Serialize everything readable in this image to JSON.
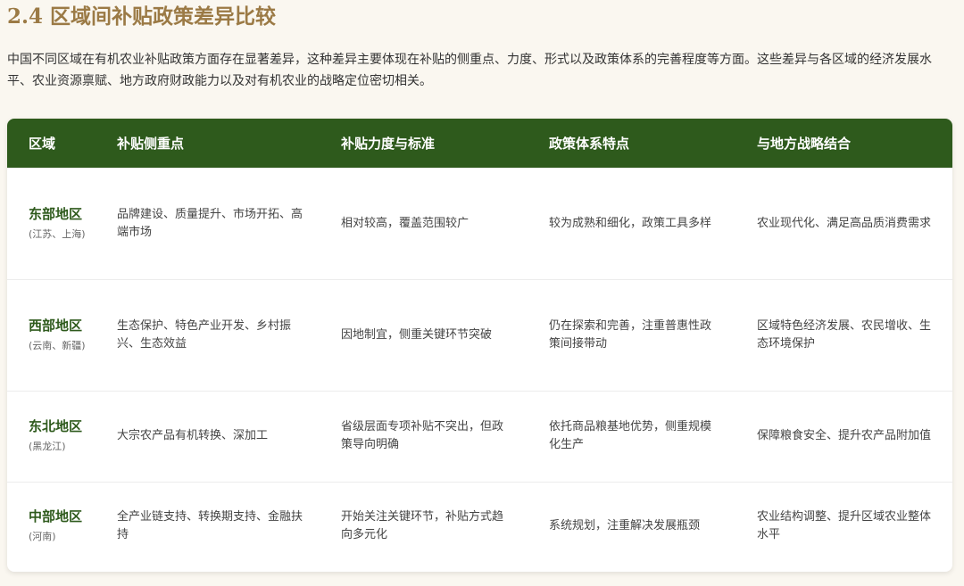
{
  "heading": "2.4 区域间补贴政策差异比较",
  "intro": "中国不同区域在有机农业补贴政策方面存在显著差异，这种差异主要体现在补贴的侧重点、力度、形式以及政策体系的完善程度等方面。这些差异与各区域的经济发展水平、农业资源禀赋、地方政府财政能力以及对有机农业的战略定位密切相关。",
  "colors": {
    "heading": "#9b7a45",
    "header_bg": "#2e5a1c",
    "region_text": "#2e5a1c",
    "page_bg": "#faf7f0"
  },
  "table": {
    "headers": [
      "区域",
      "补贴侧重点",
      "补贴力度与标准",
      "政策体系特点",
      "与地方战略结合"
    ],
    "rows": [
      {
        "region": "东部地区",
        "provinces": "(江苏、上海)",
        "focus": "品牌建设、质量提升、市场开拓、高端市场",
        "intensity": "相对较高，覆盖范围较广",
        "system": "较为成熟和细化，政策工具多样",
        "strategy": "农业现代化、满足高品质消费需求"
      },
      {
        "region": "西部地区",
        "provinces": "(云南、新疆)",
        "focus": "生态保护、特色产业开发、乡村振兴、生态效益",
        "intensity": "因地制宜，侧重关键环节突破",
        "system": "仍在探索和完善，注重普惠性政策间接带动",
        "strategy": "区域特色经济发展、农民增收、生态环境保护"
      },
      {
        "region": "东北地区",
        "provinces": "(黑龙江)",
        "focus": "大宗农产品有机转换、深加工",
        "intensity": "省级层面专项补贴不突出，但政策导向明确",
        "system": "依托商品粮基地优势，侧重规模化生产",
        "strategy": "保障粮食安全、提升农产品附加值"
      },
      {
        "region": "中部地区",
        "provinces": "(河南)",
        "focus": "全产业链支持、转换期支持、金融扶持",
        "intensity": "开始关注关键环节，补贴方式趋向多元化",
        "system": "系统规划，注重解决发展瓶颈",
        "strategy": "农业结构调整、提升区域农业整体水平"
      }
    ]
  }
}
